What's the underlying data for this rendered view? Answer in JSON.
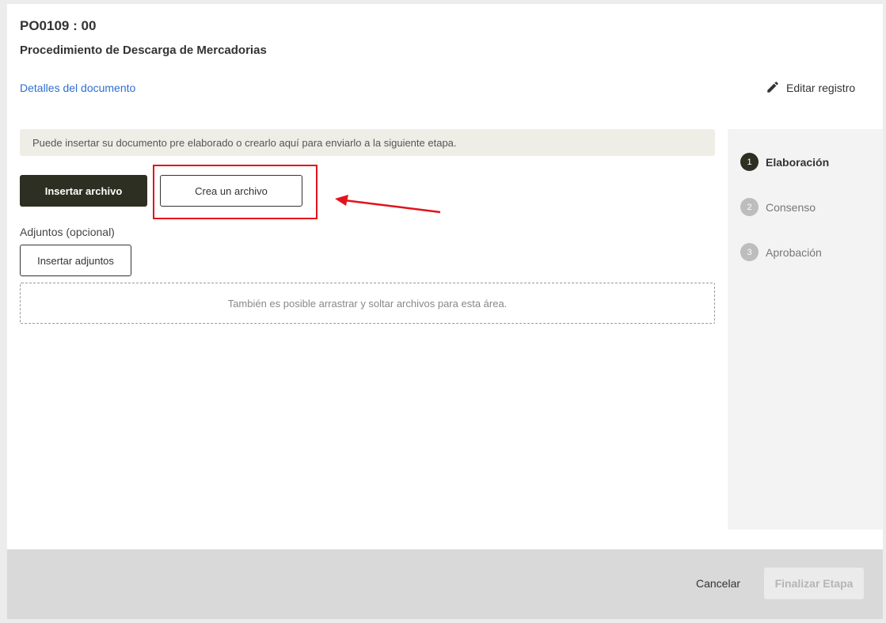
{
  "header": {
    "doc_code": "PO0109 : 00",
    "doc_title": "Procedimiento de Descarga de Mercadorias",
    "details_link": "Detalles del documento",
    "edit_label": "Editar registro"
  },
  "main": {
    "info_text": "Puede insertar su documento pre elaborado o crearlo aquí para enviarlo a la siguiente etapa.",
    "insert_file_label": "Insertar archivo",
    "create_file_label": "Crea un archivo",
    "attachments_label": "Adjuntos (opcional)",
    "insert_attachments_label": "Insertar adjuntos",
    "dropzone_text": "También es posible arrastrar y soltar archivos para esta área."
  },
  "steps": [
    {
      "number": "1",
      "label": "Elaboración",
      "active": true
    },
    {
      "number": "2",
      "label": "Consenso",
      "active": false
    },
    {
      "number": "3",
      "label": "Aprobación",
      "active": false
    }
  ],
  "footer": {
    "cancel_label": "Cancelar",
    "finalize_label": "Finalizar Etapa"
  },
  "colors": {
    "primary": "#2c2f21",
    "link": "#2f6fd0",
    "annotation": "#e3121b",
    "info_bg": "#eeeee7"
  },
  "icons": {
    "edit": "pencil-icon"
  }
}
